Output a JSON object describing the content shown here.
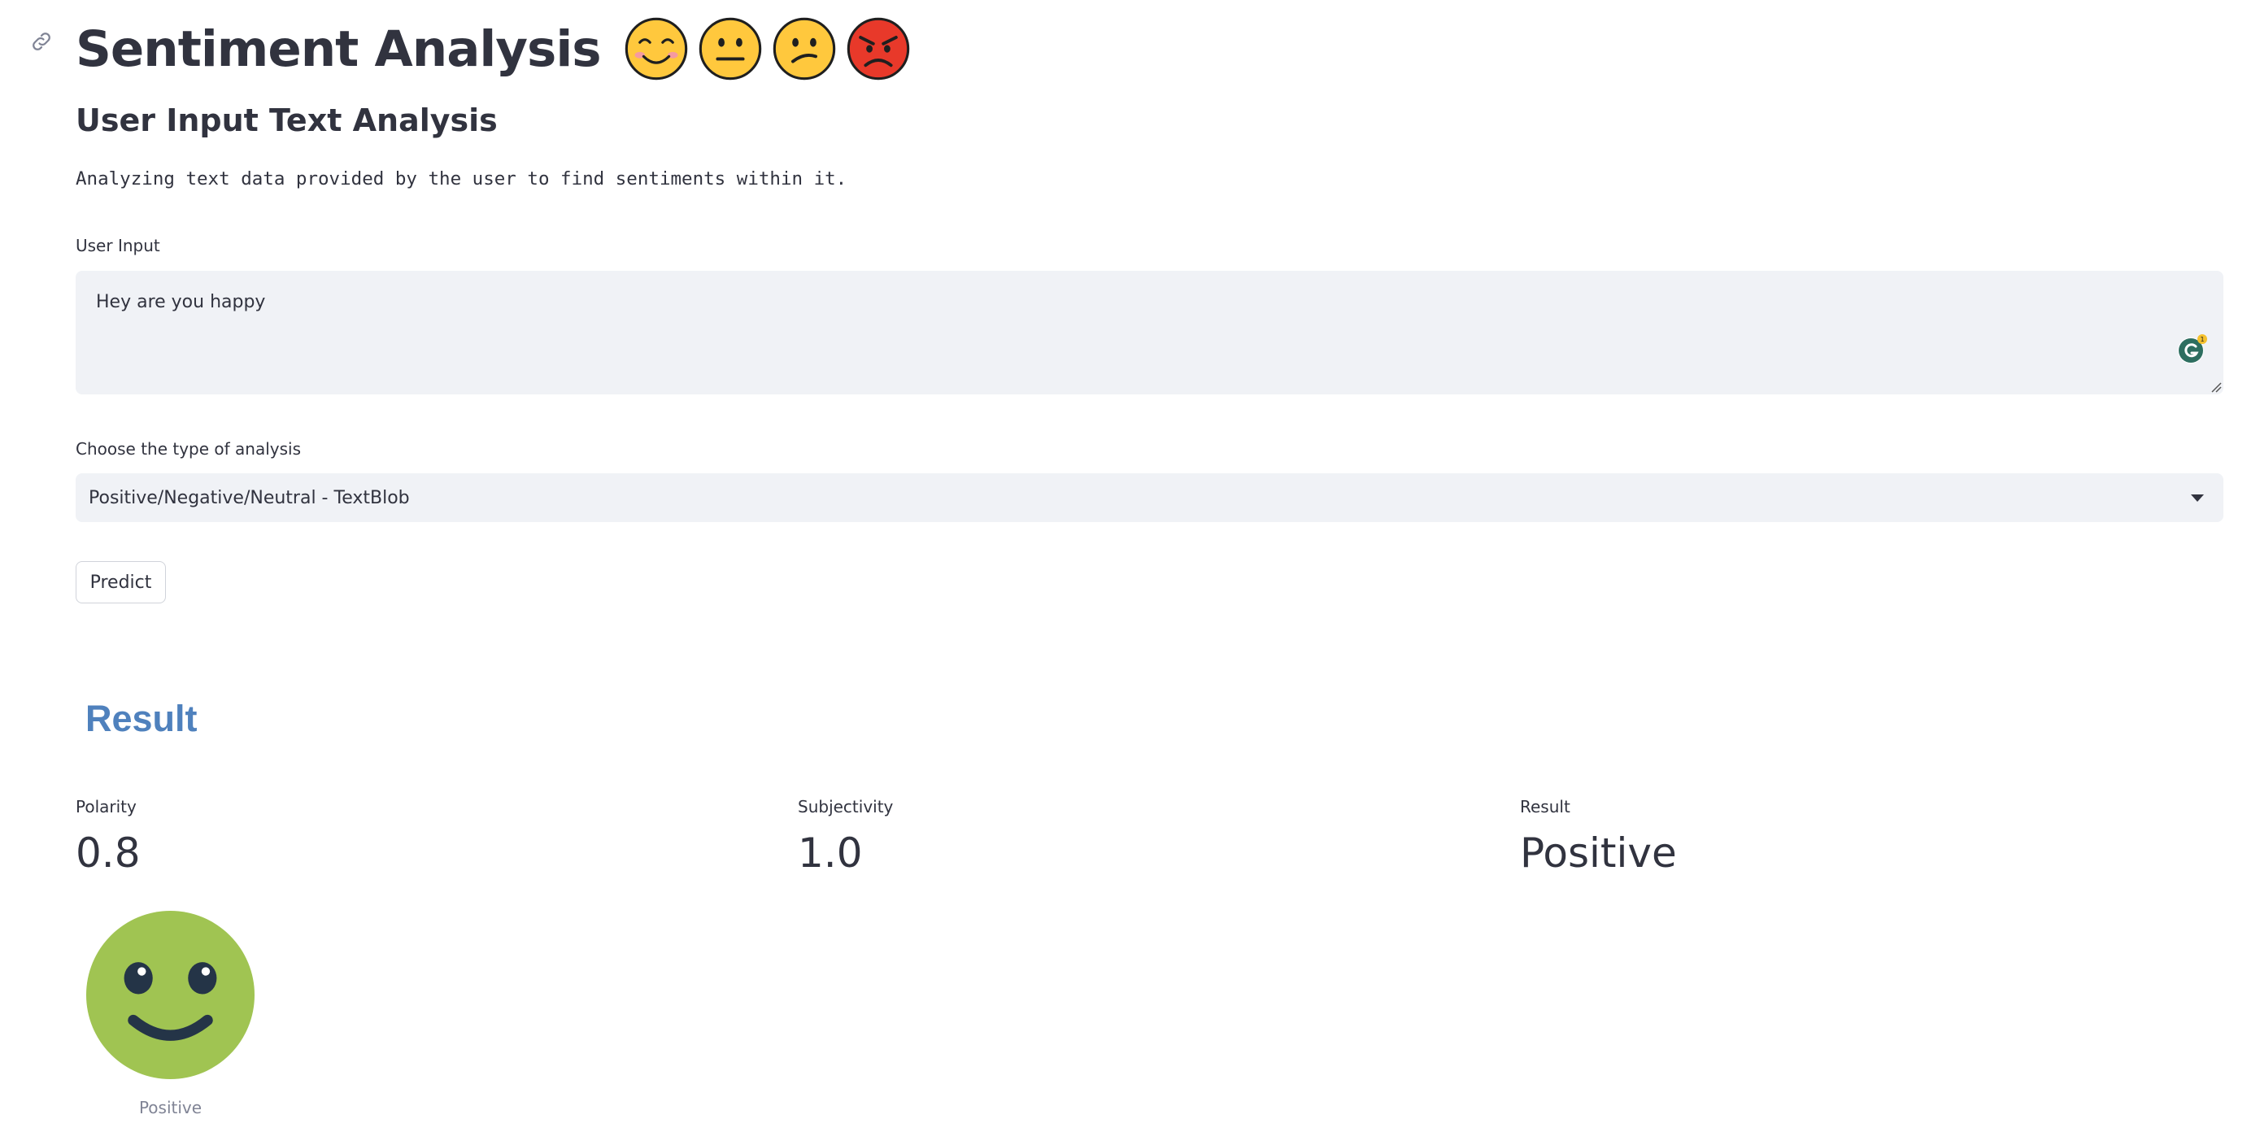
{
  "header": {
    "title": "Sentiment Analysis",
    "emojis": [
      "smiling-face-icon",
      "neutral-face-icon",
      "confused-face-icon",
      "angry-face-icon"
    ]
  },
  "section": {
    "subheader": "User Input Text Analysis",
    "description": "Analyzing text data provided by the user to find sentiments within it."
  },
  "input": {
    "label": "User Input",
    "value": "Hey are you happy"
  },
  "analysis_select": {
    "label": "Choose the type of analysis",
    "selected": "Positive/Negative/Neutral - TextBlob"
  },
  "predict_button": {
    "label": "Predict"
  },
  "result": {
    "heading": "Result",
    "metrics": [
      {
        "label": "Polarity",
        "value": "0.8"
      },
      {
        "label": "Subjectivity",
        "value": "1.0"
      },
      {
        "label": "Result",
        "value": "Positive"
      }
    ],
    "image_caption": "Positive"
  },
  "colors": {
    "accent": "#4f81bd",
    "smiley": "#a0c452",
    "input_bg": "#f0f2f6",
    "text": "#31333f"
  }
}
